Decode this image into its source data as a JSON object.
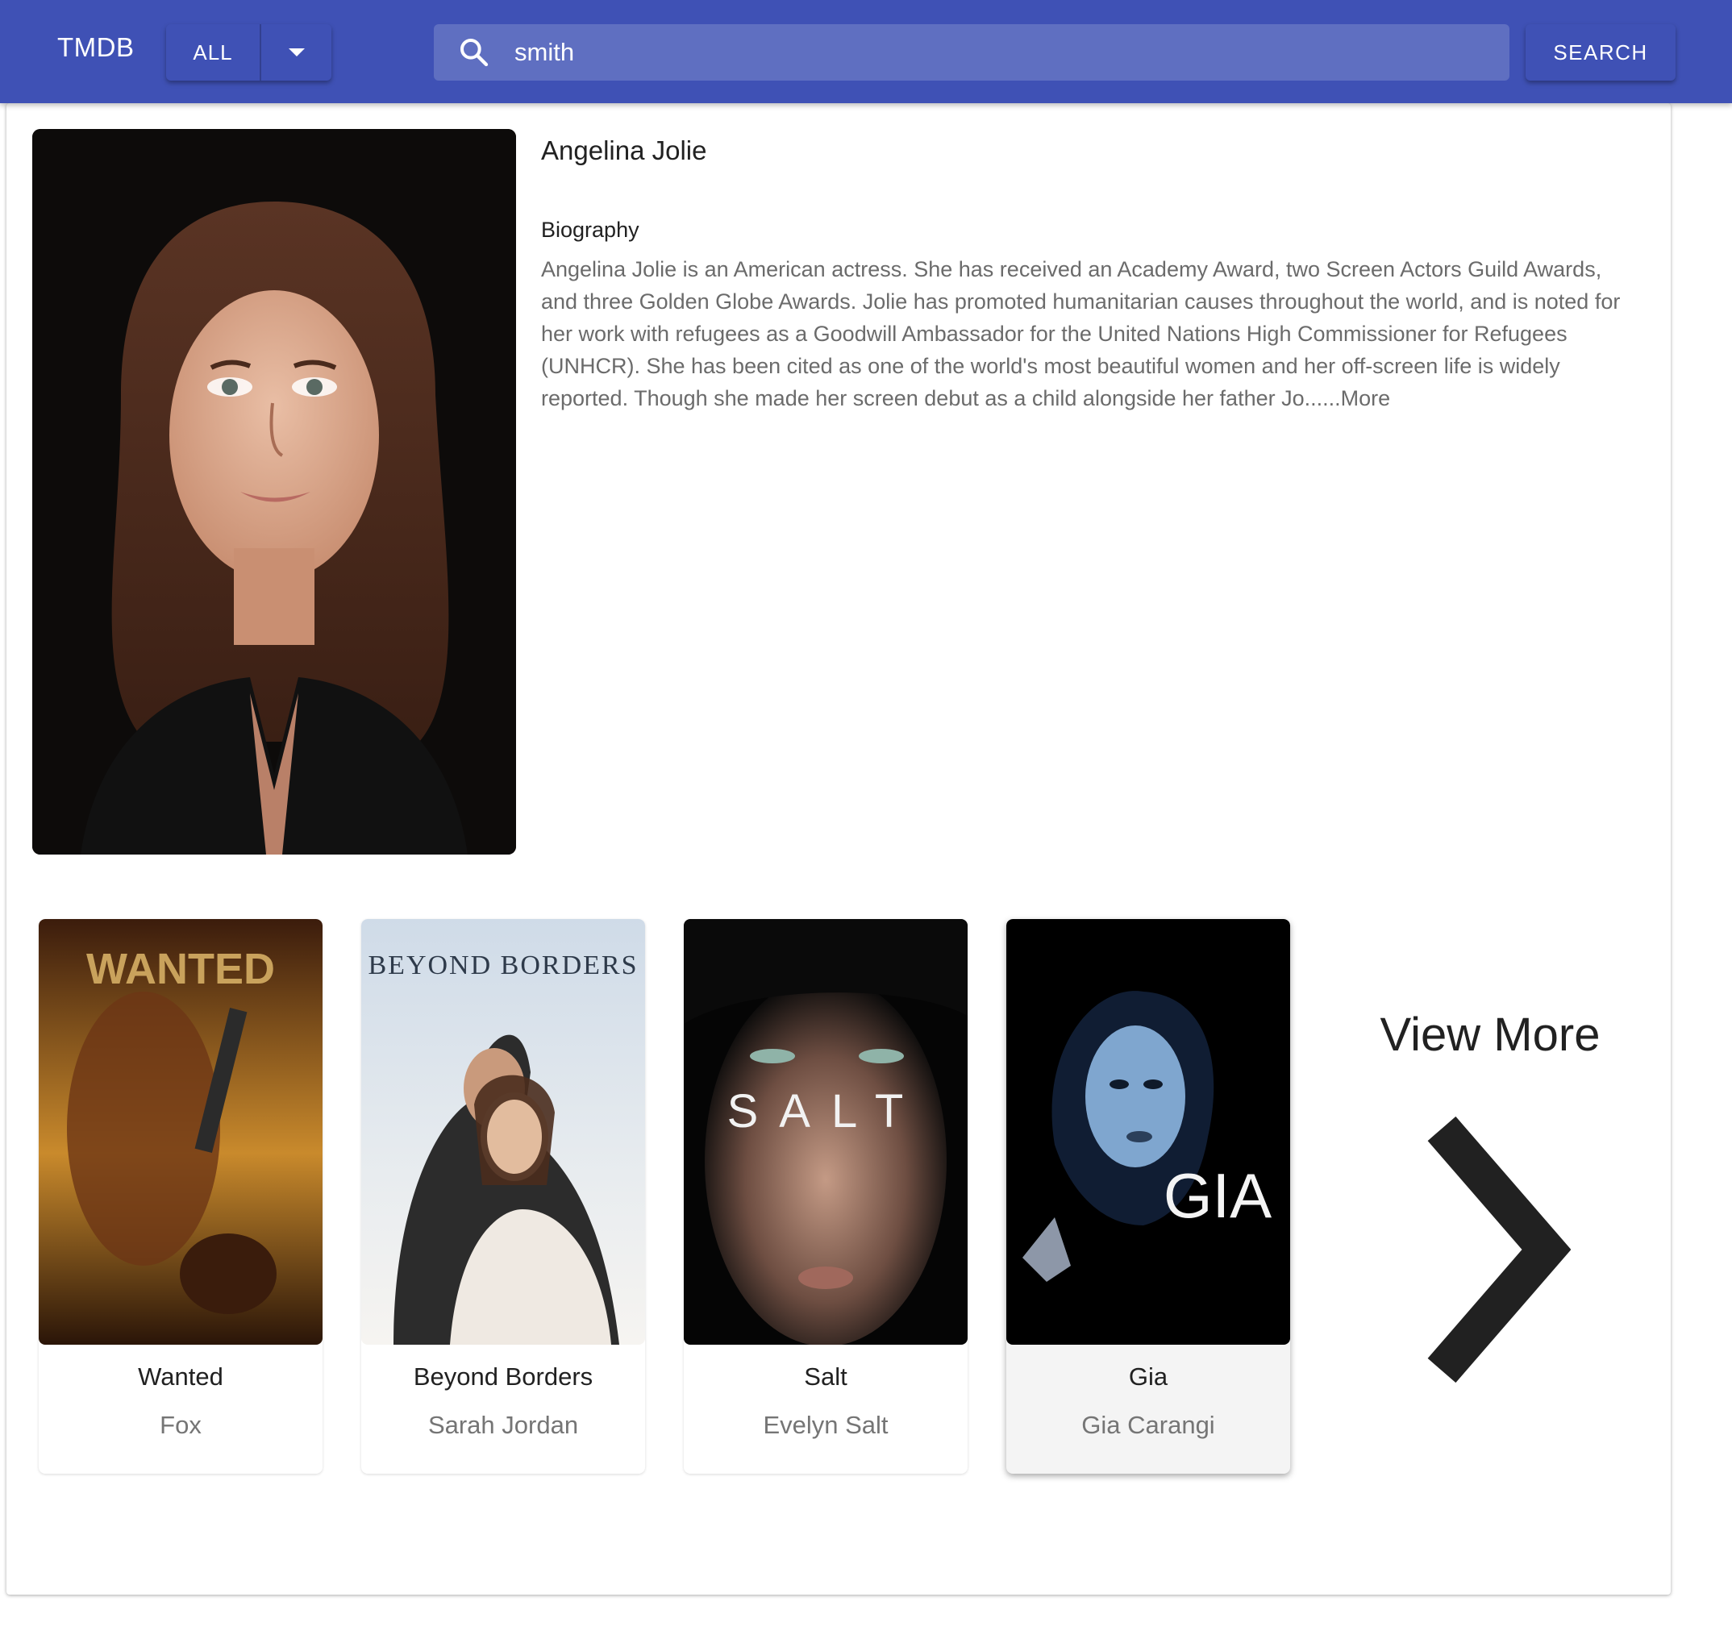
{
  "appbar": {
    "brand": "TMDB",
    "filter_label": "ALL",
    "search_value": "smith",
    "search_button": "SEARCH",
    "color": "#3f51b5"
  },
  "person": {
    "name": "Angelina Jolie",
    "bio_heading": "Biography",
    "bio_text": "Angelina Jolie is an American actress. She has received an Academy Award, two Screen Actors Guild Awards, and three Golden Globe Awards. Jolie has promoted humanitarian causes throughout the world, and is noted for her work with refugees as a Goodwill Ambassador for the United Nations High Commissioner for Refugees (UNHCR). She has been cited as one of the world's most beautiful women and her off-screen life is widely reported. Though she made her screen debut as a child alongside her father Jo......More"
  },
  "movies": [
    {
      "title": "Wanted",
      "role": "Fox",
      "poster_text": "WANTED"
    },
    {
      "title": "Beyond Borders",
      "role": "Sarah Jordan",
      "poster_text": "BEYOND  BORDERS"
    },
    {
      "title": "Salt",
      "role": "Evelyn Salt",
      "poster_text": "SALT"
    },
    {
      "title": "Gia",
      "role": "Gia Carangi",
      "poster_text": "GIA"
    }
  ],
  "view_more": {
    "label": "View More",
    "icon": "chevron-right-icon"
  }
}
